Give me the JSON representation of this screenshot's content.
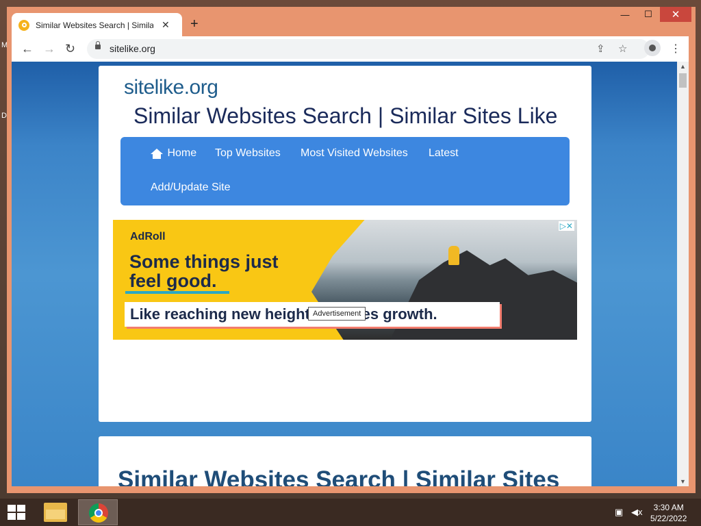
{
  "desktop": {
    "edge_label_1": "M",
    "edge_label_2": "D"
  },
  "window_controls": {
    "minimize": "—",
    "maximize": "☐",
    "close": "✕"
  },
  "tab": {
    "title": "Similar Websites Search | Similar",
    "close": "✕",
    "new_tab": "+"
  },
  "toolbar": {
    "back": "←",
    "forward": "→",
    "reload": "↻",
    "url": "sitelike.org",
    "share": "⇪",
    "bookmark": "☆",
    "menu": "⋮"
  },
  "page": {
    "logo": "sitelike.org",
    "heading": "Similar Websites Search | Similar Sites Like",
    "nav": [
      "Home",
      "Top Websites",
      "Most Visited Websites",
      "Latest",
      "Add/Update Site"
    ],
    "ad": {
      "brand": "AdRoll",
      "headline_line1": "Some things just",
      "headline_line2": "feel good.",
      "subline": "Like reaching new heights of sales growth.",
      "choices": "▷✕"
    },
    "tooltip": "Advertisement",
    "second_heading": "Similar Websites Search | Similar Sites"
  },
  "taskbar": {
    "time": "3:30 AM",
    "date": "5/22/2022"
  },
  "colors": {
    "nav_bg": "#3d87e0",
    "logo": "#1f5d8c",
    "ad_bg": "#f9c714",
    "frame": "#e8956f"
  }
}
